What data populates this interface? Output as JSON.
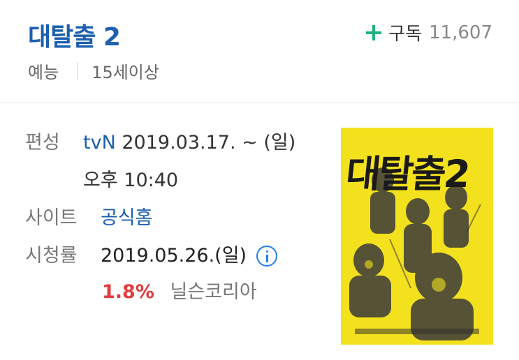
{
  "program": {
    "title": "대탈출 2",
    "subscribe_label": "구독",
    "subscriber_count": "11,607",
    "genre": "예능",
    "age_rating": "15세이상"
  },
  "info": {
    "broadcast_label": "편성",
    "channel": "tvN",
    "schedule_date": "2019.03.17. ~ (일)",
    "schedule_time": "오후 10:40",
    "site_label": "사이트",
    "site_link": "공식홈",
    "rating_label": "시청률",
    "rating_date": "2019.05.26.(일)",
    "rating_value": "1.8%",
    "rating_source": "닐슨코리아"
  },
  "poster": {
    "title_text": "대탈출2",
    "background_color": "#f4e11e"
  },
  "colors": {
    "title_blue": "#1d5fb0",
    "plus_green": "#1fb37e",
    "rating_red": "#e23b3b"
  }
}
